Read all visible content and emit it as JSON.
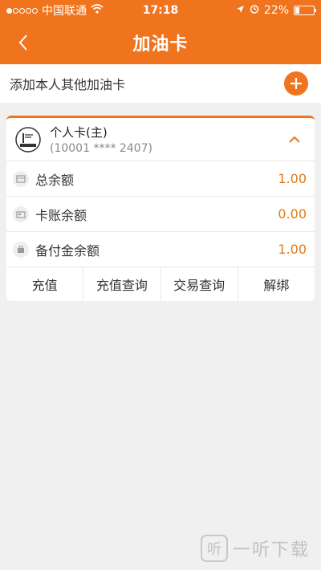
{
  "status_bar": {
    "carrier": "中国联通",
    "time": "17:18",
    "battery": "22%",
    "battery_level": 0.22
  },
  "navbar": {
    "title": "加油卡"
  },
  "add_card": {
    "label": "添加本人其他加油卡"
  },
  "card": {
    "name": "个人卡(主)",
    "number": "(10001 **** 2407)",
    "balances": [
      {
        "label": "总余额",
        "value": "1.00",
        "icon": "wallet-icon"
      },
      {
        "label": "卡账余额",
        "value": "0.00",
        "icon": "card-icon"
      },
      {
        "label": "备付金余额",
        "value": "1.00",
        "icon": "reserve-icon"
      }
    ],
    "actions": [
      {
        "label": "充值"
      },
      {
        "label": "充值查询"
      },
      {
        "label": "交易查询"
      },
      {
        "label": "解绑"
      }
    ]
  },
  "watermark": {
    "glyph": "听",
    "text": "一听下载"
  },
  "colors": {
    "accent": "#f0741e",
    "amount": "#e07b1a",
    "background": "#f0f0f0"
  }
}
